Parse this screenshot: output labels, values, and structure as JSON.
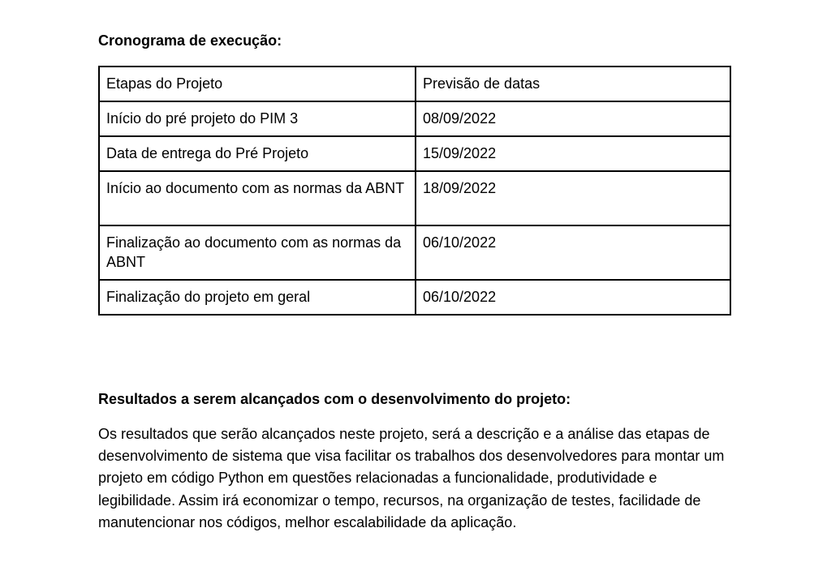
{
  "schedule": {
    "heading": "Cronograma de execução:",
    "columns": [
      "Etapas do Projeto",
      "Previsão de datas"
    ],
    "rows": [
      {
        "stage": "Início do pré projeto do PIM 3",
        "date": "08/09/2022"
      },
      {
        "stage": "Data de entrega do Pré Projeto",
        "date": "15/09/2022"
      },
      {
        "stage": "Início ao documento com as normas da ABNT",
        "date": "18/09/2022"
      },
      {
        "stage": "Finalização ao documento com as normas da ABNT",
        "date": "06/10/2022"
      },
      {
        "stage": "Finalização do projeto em geral",
        "date": "06/10/2022"
      }
    ]
  },
  "results": {
    "heading": "Resultados a serem alcançados com o desenvolvimento do projeto:",
    "paragraph": "Os resultados que serão alcançados neste projeto, será a descrição e a análise das etapas de desenvolvimento de sistema que visa facilitar os trabalhos dos desenvolvedores para montar um projeto em código Python em questões relacionadas a funcionalidade, produtividade e legibilidade. Assim irá economizar o tempo, recursos, na organização de testes, facilidade de manutencionar nos códigos, melhor escalabilidade da aplicação."
  }
}
